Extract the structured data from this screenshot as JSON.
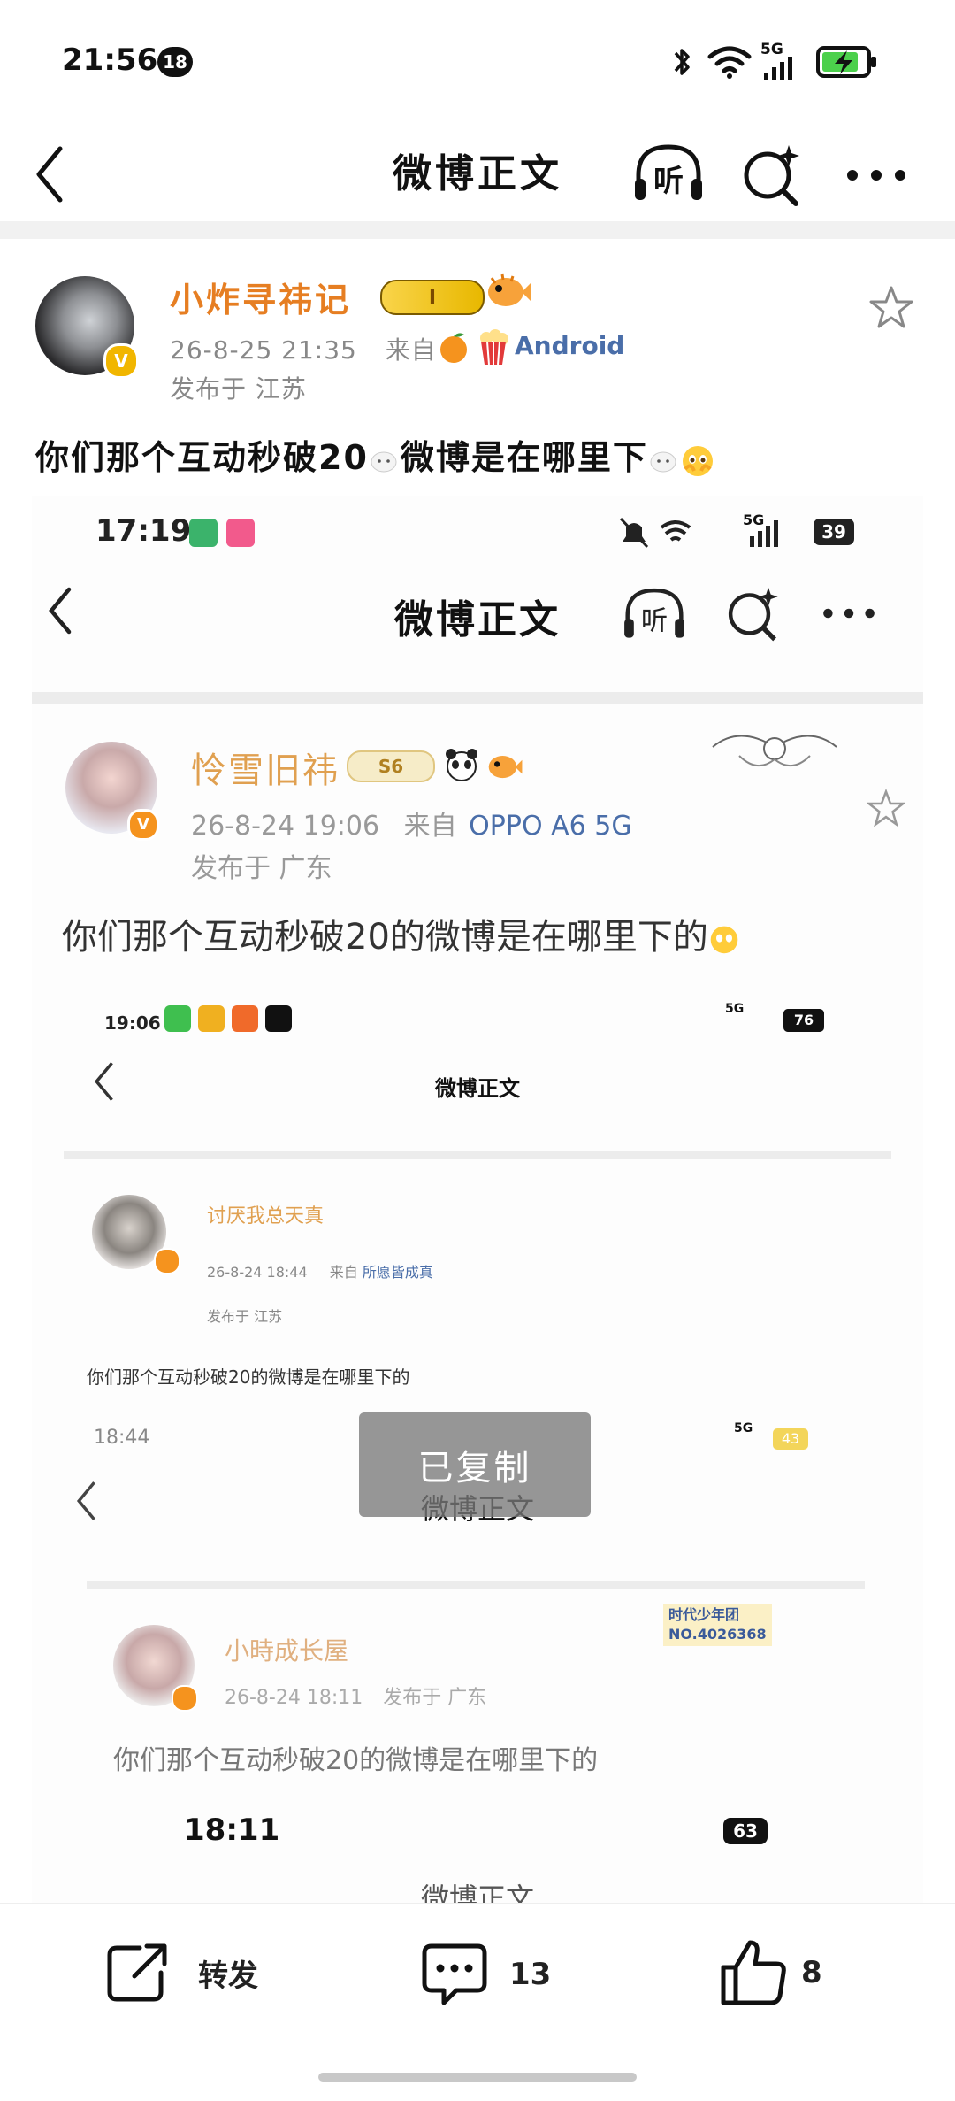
{
  "status_bar": {
    "time": "21:56",
    "notification_count": "18",
    "network": "5G"
  },
  "nav": {
    "title": "微博正文"
  },
  "post": {
    "username": "小炸寻祎记",
    "level_badge": "I",
    "timestamp": "26-8-25 21:35",
    "source_prefix": "来自",
    "source": "Android",
    "location": "发布于 江苏",
    "text": "你们那个互动秒破20",
    "text_mid": "微博是在哪里下"
  },
  "screenshot1": {
    "time": "17:19",
    "network": "5G",
    "battery": "39",
    "nav_title": "微博正文",
    "username": "怜雪旧祎",
    "badge": "S6",
    "timestamp": "26-8-24 19:06",
    "source_prefix": "来自",
    "source": "OPPO A6 5G",
    "location": "发布于 广东",
    "text": "你们那个互动秒破20的微博是在哪里下的"
  },
  "screenshot2": {
    "time": "19:06",
    "network": "5G",
    "battery": "76",
    "nav_title": "微博正文",
    "username": "讨厌我总天真",
    "timestamp": "26-8-24 18:44",
    "source_prefix": "来自",
    "source": "所愿皆成真",
    "location": "发布于 江苏",
    "text": "你们那个互动秒破20的微博是在哪里下的"
  },
  "screenshot3": {
    "time": "18:44",
    "network": "5G",
    "battery": "43",
    "nav_title": "微博正文",
    "username": "小時成长屋",
    "timestamp": "26-8-24 18:11",
    "location": "发布于 广东",
    "badge_title": "时代少年团",
    "badge_no": "NO.4026368",
    "text": "你们那个互动秒破20的微博是在哪里下的"
  },
  "screenshot4": {
    "time": "18:11",
    "battery": "63",
    "nav_title": "微博正文"
  },
  "toast": {
    "text": "已复制"
  },
  "bottom_bar": {
    "repost_label": "转发",
    "comment_count": "13",
    "like_count": "8"
  },
  "colors": {
    "username": "#e67e22",
    "verified": "#f1b600",
    "source_link": "#4a6ea9"
  }
}
